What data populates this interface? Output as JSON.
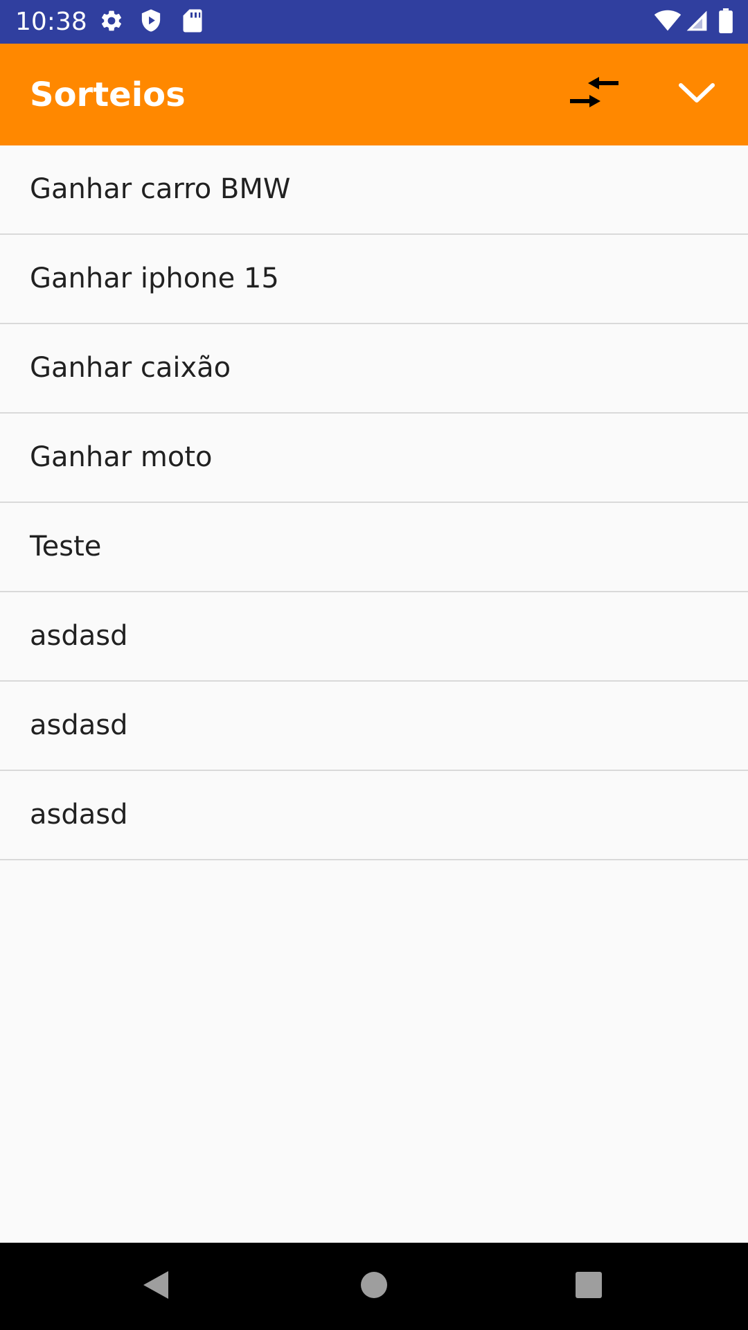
{
  "status_bar": {
    "time": "10:38",
    "left_icons": [
      "settings-icon",
      "shield-icon",
      "sd-card-icon"
    ],
    "right_icons": [
      "wifi-icon",
      "signal-icon",
      "battery-icon"
    ],
    "background_color": "#303f9f"
  },
  "app_bar": {
    "title": "Sorteios",
    "background_color": "#ff8800",
    "actions": [
      "compare-arrows-icon",
      "chevron-down-icon"
    ]
  },
  "list": {
    "items": [
      {
        "label": "Ganhar carro BMW"
      },
      {
        "label": "Ganhar iphone 15"
      },
      {
        "label": "Ganhar caixão"
      },
      {
        "label": "Ganhar moto"
      },
      {
        "label": "Teste"
      },
      {
        "label": "asdasd"
      },
      {
        "label": "asdasd"
      },
      {
        "label": "asdasd"
      }
    ]
  },
  "nav_bar": {
    "buttons": [
      "back-icon",
      "home-icon",
      "recents-icon"
    ]
  }
}
